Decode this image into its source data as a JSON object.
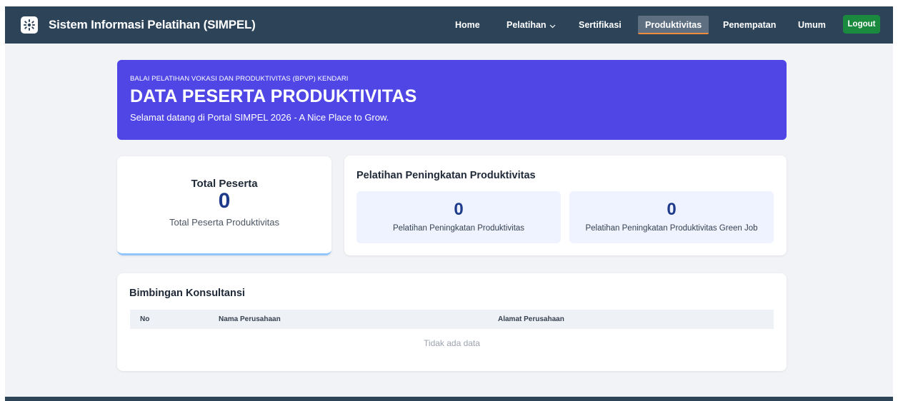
{
  "app": {
    "title": "Sistem Informasi Pelatihan (SIMPEL)",
    "logo_icon": "kemnaker-logo-icon"
  },
  "nav": {
    "items": [
      {
        "label": "Home",
        "active": false
      },
      {
        "label": "Pelatihan",
        "active": false,
        "has_dropdown": true
      },
      {
        "label": "Sertifikasi",
        "active": false
      },
      {
        "label": "Produktivitas",
        "active": true
      },
      {
        "label": "Penempatan",
        "active": false
      },
      {
        "label": "Umum",
        "active": false
      }
    ],
    "logout_label": "Logout"
  },
  "hero": {
    "kicker": "BALAI PELATIHAN VOKASI DAN PRODUKTIVITAS (BPVP) KENDARI",
    "title": "DATA PESERTA PRODUKTIVITAS",
    "subtitle": "Selamat datang di Portal SIMPEL 2026 - A Nice Place to Grow."
  },
  "total_card": {
    "title": "Total Peserta",
    "value": "0",
    "caption": "Total Peserta Produktivitas"
  },
  "productivity_card": {
    "title": "Pelatihan Peningkatan Produktivitas",
    "stats": [
      {
        "value": "0",
        "label": "Pelatihan Peningkatan Produktivitas"
      },
      {
        "value": "0",
        "label": "Pelatihan Peningkatan Produktivitas Green Job"
      }
    ]
  },
  "consult_card": {
    "title": "Bimbingan Konsultansi",
    "columns": [
      "No",
      "Nama Perusahaan",
      "Alamat Perusahaan"
    ],
    "empty_text": "Tidak ada data"
  },
  "colors": {
    "navbar": "#2c4358",
    "hero": "#4f46e5",
    "logout": "#1a8a3e",
    "active_underline": "#f08a3c",
    "stat_value": "#1e3a8a"
  }
}
